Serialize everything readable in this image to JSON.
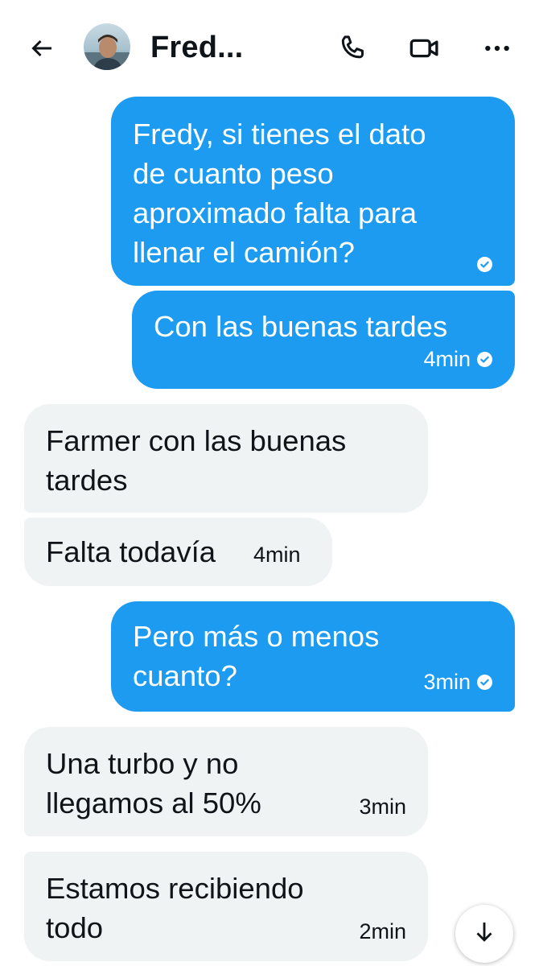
{
  "header": {
    "contact_name": "Fred...",
    "avatar": "contact-avatar-photo",
    "icons": {
      "back": "arrow-left-icon",
      "call": "phone-icon",
      "video": "video-camera-icon",
      "more": "more-horizontal-icon"
    }
  },
  "colors": {
    "sent_bubble": "#1d9bf0",
    "received_bubble": "#eff3f4",
    "text": "#0f1419"
  },
  "messages": [
    {
      "direction": "sent",
      "lines": [
        "Fredy, si tienes el dato",
        "de cuanto peso",
        "aproximado falta para",
        "llenar el camión?"
      ],
      "time": "",
      "status": "seen-check-icon"
    },
    {
      "direction": "sent",
      "lines": [
        "Con las buenas tardes"
      ],
      "time": "4min",
      "status": "seen-check-icon"
    },
    {
      "direction": "received",
      "lines": [
        "Farmer con las buenas",
        "tardes"
      ],
      "time": ""
    },
    {
      "direction": "received",
      "lines": [
        "Falta todavía"
      ],
      "time": "4min"
    },
    {
      "direction": "sent",
      "lines": [
        "Pero más o menos",
        "cuanto?"
      ],
      "time": "3min",
      "status": "seen-check-icon"
    },
    {
      "direction": "received",
      "lines": [
        "Una turbo y no",
        "llegamos al 50%"
      ],
      "time": "3min"
    },
    {
      "direction": "received",
      "lines": [
        "Estamos recibiendo",
        "todo"
      ],
      "time": "2min"
    }
  ],
  "scroll_button": {
    "icon": "arrow-down-icon"
  }
}
